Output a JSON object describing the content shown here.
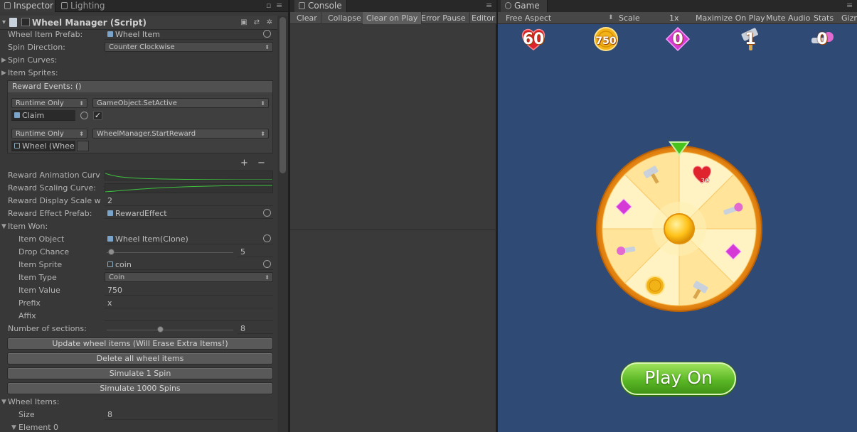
{
  "inspector": {
    "tabs": [
      {
        "label": "Inspector"
      },
      {
        "label": "Lighting"
      }
    ],
    "component_title": "Wheel Manager (Script)",
    "fields": {
      "wheel_item_prefab_label": "Wheel Item Prefab:",
      "wheel_item_prefab_value": "Wheel Item",
      "spin_direction_label": "Spin Direction:",
      "spin_direction_value": "Counter Clockwise",
      "spin_curves_label": "Spin Curves:",
      "item_sprites_label": "Item Sprites:"
    },
    "reward_events": {
      "header": "Reward Events: ()",
      "entries": [
        {
          "mode": "Runtime Only",
          "function": "GameObject.SetActive",
          "object": "Claim",
          "checkbox": true
        },
        {
          "mode": "Runtime Only",
          "function": "WheelManager.StartReward",
          "object": "Wheel (Whee"
        }
      ],
      "add": "+",
      "remove": "−"
    },
    "reward_fields": {
      "animation_curve_label": "Reward Animation Curv",
      "scaling_curve_label": "Reward Scaling Curve:",
      "display_scale_label": "Reward Display Scale w",
      "display_scale_value": "2",
      "effect_prefab_label": "Reward Effect Prefab:",
      "effect_prefab_value": "RewardEffect"
    },
    "item_won": {
      "label": "Item Won:",
      "item_object_label": "Item Object",
      "item_object_value": "Wheel Item(Clone)",
      "drop_chance_label": "Drop Chance",
      "drop_chance_value": "5",
      "item_sprite_label": "Item Sprite",
      "item_sprite_value": "coin",
      "item_type_label": "Item Type",
      "item_type_value": "Coin",
      "item_value_label": "Item Value",
      "item_value_value": "750",
      "prefix_label": "Prefix",
      "prefix_value": "x",
      "affix_label": "Affix",
      "affix_value": ""
    },
    "sections_label": "Number of sections:",
    "sections_value": "8",
    "buttons": {
      "update": "Update wheel items (Will Erase Extra Items!)",
      "delete": "Delete all wheel items",
      "simulate1": "Simulate 1 Spin",
      "simulate1000": "Simulate 1000 Spins"
    },
    "wheel_items": {
      "label": "Wheel Items:",
      "size_label": "Size",
      "size_value": "8",
      "element_label": "Element 0"
    }
  },
  "console": {
    "tab": "Console",
    "toolbar": [
      "Clear",
      "Collapse",
      "Clear on Play",
      "Error Pause",
      "Editor"
    ]
  },
  "game": {
    "tab": "Game",
    "aspect": "Free Aspect",
    "scale_label": "Scale",
    "scale_value": "1x",
    "toolbar_right": [
      "Maximize On Play",
      "Mute Audio",
      "Stats",
      "Gizmos"
    ],
    "hud": [
      {
        "kind": "heart",
        "value": "60",
        "color": "#e0242e"
      },
      {
        "kind": "coin",
        "value": "750",
        "color": "#f2b318"
      },
      {
        "kind": "gem",
        "value": "0",
        "color": "#d53ad6"
      },
      {
        "kind": "hammer",
        "value": "1",
        "color": "#c9d2dc"
      },
      {
        "kind": "key",
        "value": "0",
        "color": "#e26ad0"
      }
    ],
    "wheel_segment_colors": [
      "#fff3c3",
      "#ffe49a"
    ],
    "wheel_badge": "30",
    "play_button": "Play On"
  }
}
